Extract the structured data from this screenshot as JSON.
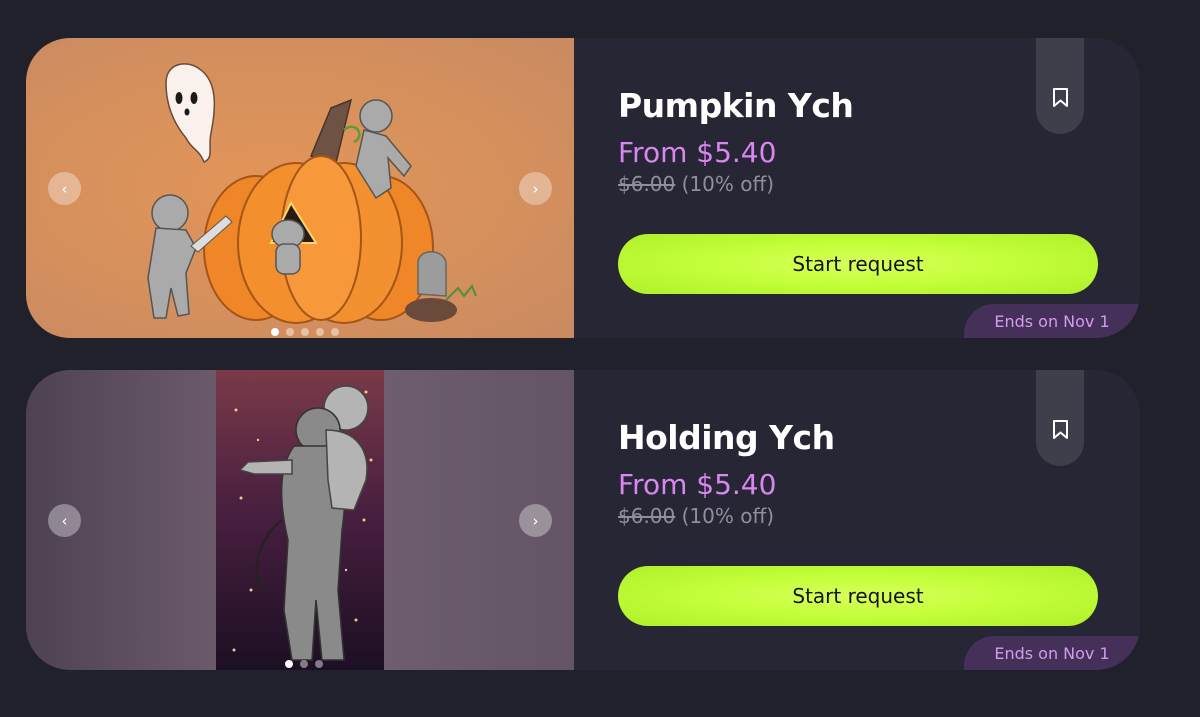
{
  "colors": {
    "page_bg": "#21212c",
    "card_bg": "#262634",
    "accent_price": "#d986f0",
    "cta_green": "#c4ff3a",
    "ends_badge_bg": "#45305a",
    "ends_badge_text": "#d49aee"
  },
  "listings": [
    {
      "title": "Pumpkin Ych",
      "price": "From $5.40",
      "original_price": "$6.00",
      "discount": "(10% off)",
      "cta_label": "Start request",
      "ends": "Ends on Nov 1",
      "bookmark_icon": "bookmark-icon",
      "image_count": 5,
      "active_image": 1
    },
    {
      "title": "Holding Ych",
      "price": "From $5.40",
      "original_price": "$6.00",
      "discount": "(10% off)",
      "cta_label": "Start request",
      "ends": "Ends on Nov 1",
      "bookmark_icon": "bookmark-icon",
      "image_count": 3,
      "active_image": 1
    }
  ],
  "carousel": {
    "prev_icon": "chevron-left-icon",
    "next_icon": "chevron-right-icon",
    "prev_glyph": "‹",
    "next_glyph": "›"
  }
}
